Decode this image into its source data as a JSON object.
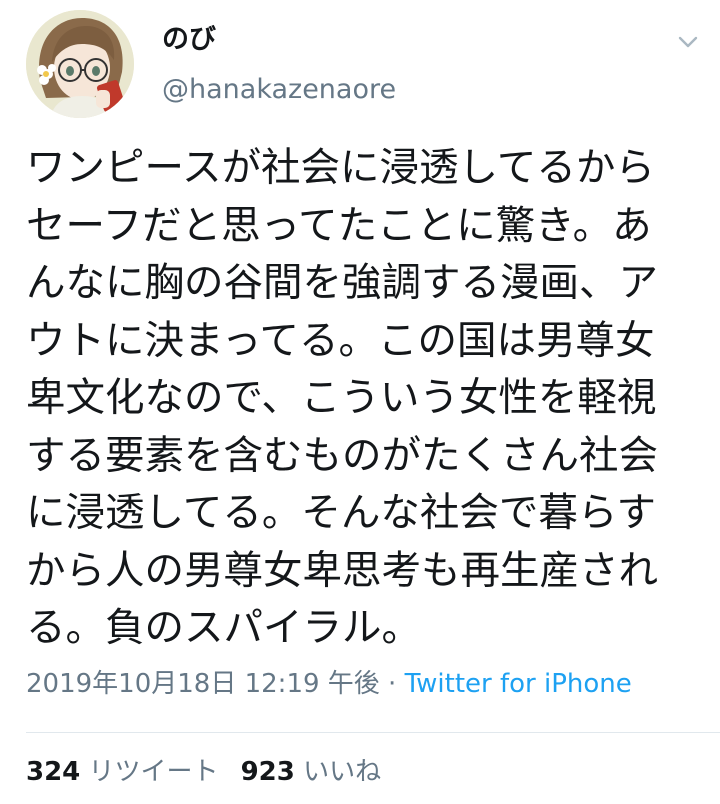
{
  "user": {
    "display_name": "のび",
    "handle": "@hanakazenaore"
  },
  "tweet": {
    "text": "ワンピースが社会に浸透してるから\nセーフだと思ってたことに驚き。あ\nんなに胸の谷間を強調する漫画、ア\nウトに決まってる。この国は男尊女\n卑文化なので、こういう女性を軽視\nする要素を含むものがたくさん社会\nに浸透してる。そんな社会で暮らす\nから人の男尊女卑思考も再生産され\nる。負のスパイラル。",
    "timestamp": "2019年10月18日 12:19 午後",
    "separator": " · ",
    "source": "Twitter for iPhone"
  },
  "stats": {
    "retweet_count": "324",
    "retweet_label": "リツイート",
    "like_count": "923",
    "like_label": "いいね"
  },
  "icons": {
    "menu": "chevron-down-icon",
    "avatar": "avatar-illustration"
  },
  "colors": {
    "text": "#14171a",
    "secondary": "#657786",
    "link": "#1da1f2",
    "divider": "#e1e8ed"
  }
}
